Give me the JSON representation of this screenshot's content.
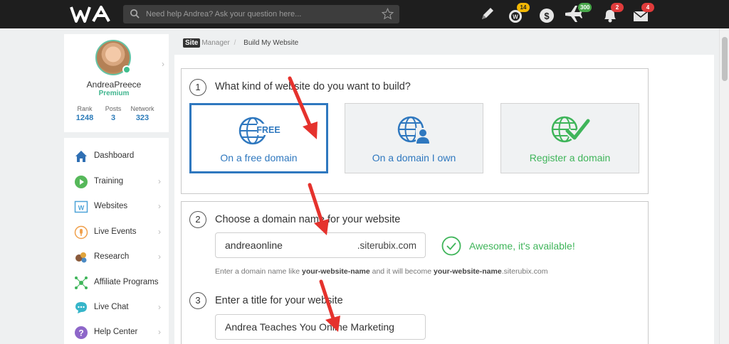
{
  "header": {
    "logo_text": "WA",
    "search_placeholder": "Need help Andrea? Ask your question here...",
    "badges": {
      "credits": "14",
      "flights": "300",
      "notifications": "2",
      "messages": "4"
    },
    "icons": [
      "pencil-icon",
      "credits-icon",
      "dollar-icon",
      "airplane-icon",
      "bell-icon",
      "envelope-icon"
    ]
  },
  "profile": {
    "username": "AndreaPreece",
    "membership": "Premium",
    "stats": [
      {
        "label": "Rank",
        "value": "1248"
      },
      {
        "label": "Posts",
        "value": "3"
      },
      {
        "label": "Network",
        "value": "323"
      }
    ]
  },
  "sidebar": {
    "items": [
      {
        "label": "Dashboard",
        "icon": "home-icon",
        "has_chevron": false
      },
      {
        "label": "Training",
        "icon": "play-icon",
        "has_chevron": true
      },
      {
        "label": "Websites",
        "icon": "websites-icon",
        "has_chevron": true
      },
      {
        "label": "Live Events",
        "icon": "live-events-icon",
        "has_chevron": true
      },
      {
        "label": "Research",
        "icon": "research-icon",
        "has_chevron": true
      },
      {
        "label": "Affiliate Programs",
        "icon": "affiliate-icon",
        "has_chevron": false
      },
      {
        "label": "Live Chat",
        "icon": "chat-icon",
        "has_chevron": true
      },
      {
        "label": "Help Center",
        "icon": "help-icon",
        "has_chevron": true
      }
    ]
  },
  "breadcrumb": {
    "site": "Site",
    "manager": "Manager",
    "separator": "/",
    "current": "Build My Website"
  },
  "step1": {
    "number": "1",
    "question": "What kind of website do you want to build?",
    "options": [
      {
        "label": "On a free domain",
        "icon": "globe-free-icon",
        "selected": true
      },
      {
        "label": "On a domain I own",
        "icon": "globe-user-icon",
        "selected": false
      },
      {
        "label": "Register a domain",
        "icon": "globe-check-icon",
        "selected": false
      }
    ],
    "free_badge_text": "FREE"
  },
  "step2": {
    "number": "2",
    "question": "Choose a domain name for your website",
    "domain_value": "andreaonline",
    "domain_suffix": ".siterubix.com",
    "availability": "Awesome, it's available!",
    "hint_pre": "Enter a domain name like ",
    "hint_bold1": "your-website-name",
    "hint_mid": " and it will become ",
    "hint_bold2": "your-website-name",
    "hint_post": ".siterubix.com"
  },
  "step3": {
    "number": "3",
    "question": "Enter a title for your website",
    "title_value": "Andrea Teaches You Online Marketing"
  },
  "colors": {
    "topbar": "#1e1e1e",
    "accent_blue": "#2f78bf",
    "success_green": "#3fb55a",
    "arrow_red": "#e5322d"
  }
}
